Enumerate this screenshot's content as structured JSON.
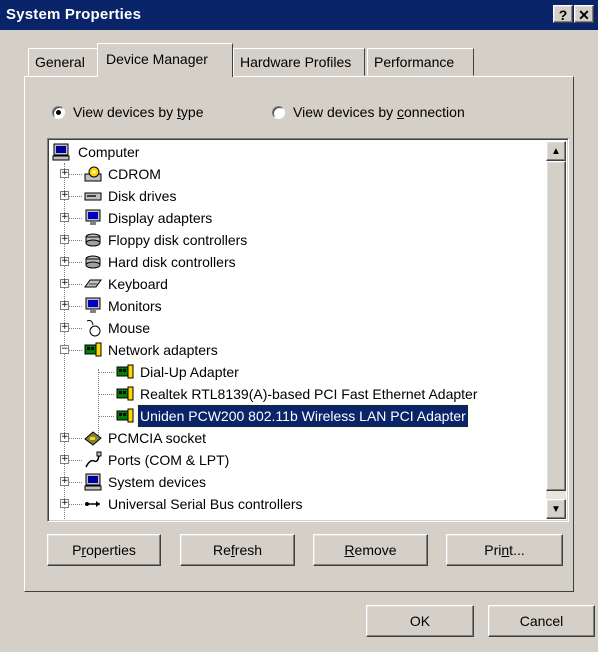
{
  "window": {
    "title": "System Properties",
    "help_label": "?",
    "close_label": "✕"
  },
  "tabs": [
    {
      "label": "General"
    },
    {
      "label": "Device Manager",
      "active": true
    },
    {
      "label": "Hardware Profiles"
    },
    {
      "label": "Performance"
    }
  ],
  "view_options": {
    "by_type": {
      "prefix": "View devices by ",
      "accel": "t",
      "suffix": "ype",
      "selected": true
    },
    "by_connection": {
      "prefix": "View devices by ",
      "accel": "c",
      "suffix": "onnection",
      "selected": false
    }
  },
  "tree": {
    "root": "Computer",
    "items": [
      {
        "label": "CDROM",
        "icon": "cdrom-icon"
      },
      {
        "label": "Disk drives",
        "icon": "disk-drive-icon"
      },
      {
        "label": "Display adapters",
        "icon": "monitor-icon"
      },
      {
        "label": "Floppy disk controllers",
        "icon": "controller-icon"
      },
      {
        "label": "Hard disk controllers",
        "icon": "controller-icon"
      },
      {
        "label": "Keyboard",
        "icon": "keyboard-icon"
      },
      {
        "label": "Monitors",
        "icon": "monitor-icon"
      },
      {
        "label": "Mouse",
        "icon": "mouse-icon"
      },
      {
        "label": "Network adapters",
        "icon": "network-card-icon",
        "expanded": true,
        "children": [
          {
            "label": "Dial-Up Adapter"
          },
          {
            "label": "Realtek RTL8139(A)-based PCI Fast Ethernet Adapter"
          },
          {
            "label": "Uniden PCW200 802.11b Wireless LAN PCI Adapter",
            "selected": true
          }
        ]
      },
      {
        "label": "PCMCIA socket",
        "icon": "pcmcia-icon"
      },
      {
        "label": "Ports (COM & LPT)",
        "icon": "port-icon"
      },
      {
        "label": "System devices",
        "icon": "computer-icon"
      },
      {
        "label": "Universal Serial Bus controllers",
        "icon": "usb-icon"
      }
    ]
  },
  "buttons": {
    "properties": {
      "pre": "P",
      "accel": "r",
      "post": "operties"
    },
    "refresh": {
      "pre": "Re",
      "accel": "f",
      "post": "resh"
    },
    "remove": {
      "pre": "",
      "accel": "R",
      "post": "emove"
    },
    "print": {
      "pre": "Pri",
      "accel": "n",
      "post": "t..."
    },
    "ok": "OK",
    "cancel": "Cancel"
  },
  "colors": {
    "titlebar": "#0a246a",
    "face": "#d4d0c8",
    "selection": "#0a246a"
  }
}
